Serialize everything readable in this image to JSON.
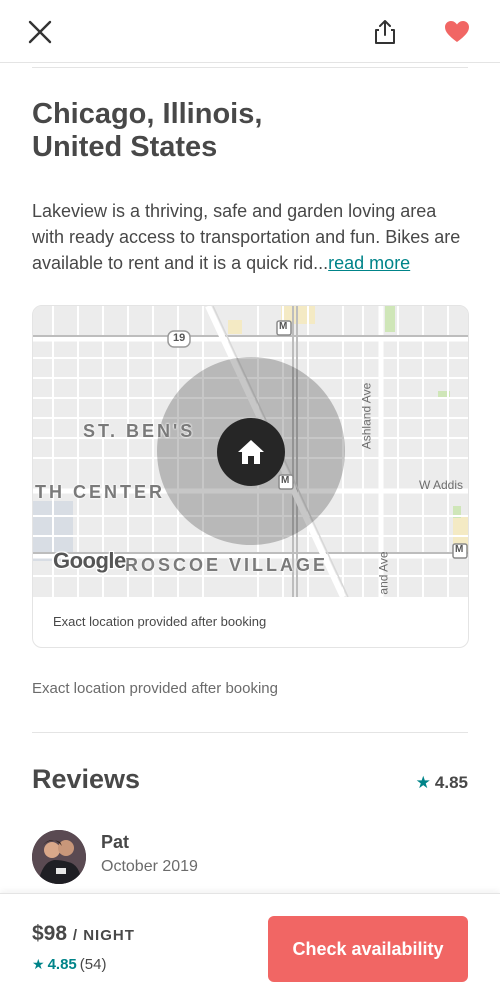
{
  "header": {
    "close_icon": "close-icon",
    "share_icon": "share-icon",
    "favorite_icon": "heart-icon",
    "favorite_color": "#f16664"
  },
  "listing": {
    "title_line1": "Chicago, Illinois,",
    "title_line2": "United States",
    "description": "Lakeview is a thriving, safe and garden loving area with ready access to transportation and fun.  Bikes are available to rent and it is a quick rid...",
    "read_more": "read more"
  },
  "map": {
    "labels": {
      "st_bens": "ST. BEN'S",
      "th_center": "TH CENTER",
      "roscoe_village": "ROSCOE VILLAGE",
      "ashland_ave": "Ashland Ave",
      "ashland_ave_lower": "and Ave",
      "w_addison": "W Addis",
      "route": "19",
      "metro": "M"
    },
    "logo": "Google",
    "caption": "Exact location provided after booking"
  },
  "location_note": "Exact location provided after booking",
  "reviews": {
    "title": "Reviews",
    "rating": "4.85",
    "items": [
      {
        "name": "Pat",
        "date": "October 2019"
      }
    ]
  },
  "footer": {
    "price": "$98",
    "per_night": "/ NIGHT",
    "rating": "4.85",
    "count": "(54)",
    "cta": "Check availability"
  },
  "colors": {
    "accent": "#008489",
    "brand": "#f16664"
  }
}
